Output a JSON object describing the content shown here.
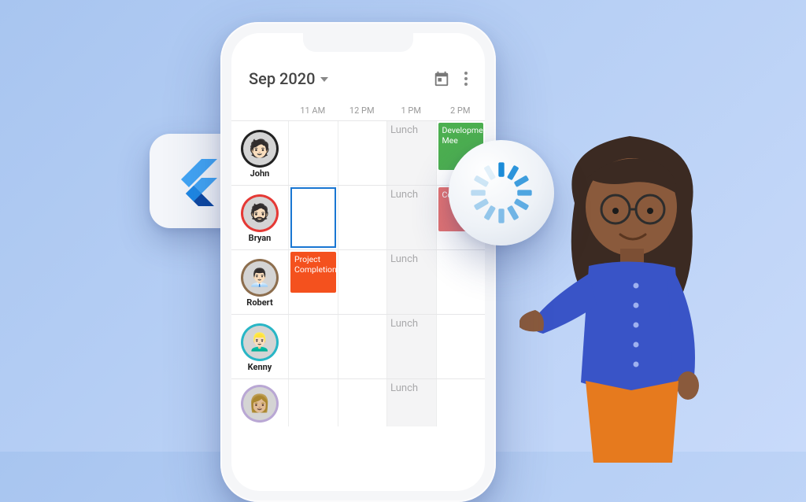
{
  "header": {
    "month_label": "Sep 2020"
  },
  "time_columns": [
    "11 AM",
    "12 PM",
    "1 PM",
    "2 PM"
  ],
  "resources": [
    {
      "name": "John",
      "ring": "ring-black"
    },
    {
      "name": "Bryan",
      "ring": "ring-red"
    },
    {
      "name": "Robert",
      "ring": "ring-brown"
    },
    {
      "name": "Kenny",
      "ring": "ring-teal"
    },
    {
      "name": "",
      "ring": "ring-lav"
    }
  ],
  "lunch_label": "Lunch",
  "events": {
    "dev_meeting": "Development Mee",
    "consulting": "Consulting",
    "project": "Project Completion"
  },
  "icons": {
    "flutter": "flutter-logo-icon",
    "spinner": "loading-spinner-icon"
  }
}
